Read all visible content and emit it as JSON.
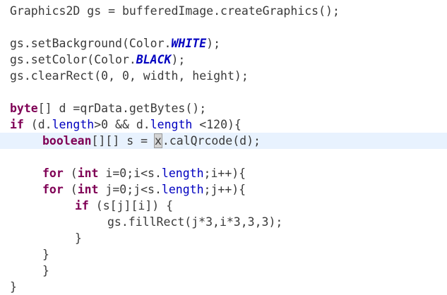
{
  "code": {
    "l1": {
      "a": "Graphics2D gs = bufferedImage.createGraphics();"
    },
    "l3": {
      "a": "gs.setBackground(Color.",
      "c": "WHITE",
      "b": ");"
    },
    "l4": {
      "a": "gs.setColor(Color.",
      "c": "BLACK",
      "b": ");"
    },
    "l5": {
      "a": "gs.clearRect(0, 0, width, height);"
    },
    "l7": {
      "kw": "byte",
      "a": "[] d =qrData.getBytes();"
    },
    "l8": {
      "kw": "if",
      "a": " (d.",
      "f1": "length",
      "b": ">0 && d.",
      "f2": "length",
      "c": " <120){"
    },
    "l9": {
      "kw": "boolean",
      "a": "[][] s = ",
      "sel": "x",
      "b": ".calQrcode(d);"
    },
    "l11": {
      "kw1": "for",
      "a": " (",
      "kw2": "int",
      "b": " i=0;i<s.",
      "f": "length",
      "c": ";i++){"
    },
    "l12": {
      "kw1": "for",
      "a": " (",
      "kw2": "int",
      "b": " j=0;j<s.",
      "f": "length",
      "c": ";j++){"
    },
    "l13": {
      "kw": "if",
      "a": " (s[j][i]) {"
    },
    "l14": {
      "a": "gs.fillRect(j*3,i*3,3,3);"
    },
    "l15": {
      "a": "}"
    },
    "l16": {
      "a": "}"
    },
    "l17": {
      "a": "}"
    },
    "l18": {
      "a": "}"
    }
  },
  "colors": {
    "keyword": "#7f0055",
    "constant": "#0000c0",
    "current_line": "#e8f2fe",
    "text": "#3a3a3a"
  }
}
